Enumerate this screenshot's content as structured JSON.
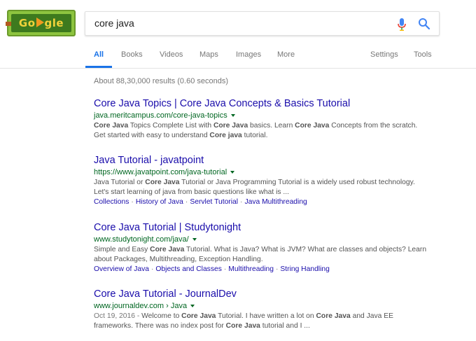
{
  "logo": {
    "text_pre": "Go",
    "text_post": "gle"
  },
  "search": {
    "query": "core java"
  },
  "tabs": [
    {
      "label": "All",
      "active": true
    },
    {
      "label": "Books"
    },
    {
      "label": "Videos"
    },
    {
      "label": "Maps"
    },
    {
      "label": "Images"
    },
    {
      "label": "More"
    },
    {
      "label": "Settings"
    },
    {
      "label": "Tools"
    }
  ],
  "stats": "About 88,30,000 results (0.60 seconds)",
  "results": [
    {
      "title": "Core Java Topics | Core Java Concepts & Basics Tutorial",
      "url": "java.meritcampus.com/core-java-topics",
      "snippet": [
        [
          [
            "b",
            "Core Java"
          ],
          [
            "t",
            " Topics Complete List with "
          ],
          [
            "b",
            "Core Java"
          ],
          [
            "t",
            " basics. Learn "
          ],
          [
            "b",
            "Core Java"
          ],
          [
            "t",
            " Concepts from the scratch."
          ]
        ],
        [
          [
            "t",
            "Get started with easy to understand "
          ],
          [
            "b",
            "Core java"
          ],
          [
            "t",
            " tutorial."
          ]
        ]
      ],
      "sitelinks": []
    },
    {
      "title": "Java Tutorial - javatpoint",
      "url": "https://www.javatpoint.com/java-tutorial",
      "snippet": [
        [
          [
            "t",
            "Java Tutorial or "
          ],
          [
            "b",
            "Core Java"
          ],
          [
            "t",
            " Tutorial or Java Programming Tutorial is a widely used robust technology."
          ]
        ],
        [
          [
            "t",
            "Let's start learning of java from basic questions like what is ..."
          ]
        ]
      ],
      "sitelinks": [
        "Collections",
        "History of Java",
        "Servlet Tutorial",
        "Java Multithreading"
      ]
    },
    {
      "title": "Core Java Tutorial | Studytonight",
      "url": "www.studytonight.com/java/",
      "snippet": [
        [
          [
            "t",
            "Simple and Easy "
          ],
          [
            "b",
            "Core Java"
          ],
          [
            "t",
            " Tutorial. What is Java? What is JVM? What are classes and objects? Learn"
          ]
        ],
        [
          [
            "t",
            "about Packages, Multithreading, Exception Handling."
          ]
        ]
      ],
      "sitelinks": [
        "Overview of Java",
        "Objects and Classes",
        "Multithreading",
        "String Handling"
      ]
    },
    {
      "title": "Core Java Tutorial - JournalDev",
      "url": "www.journaldev.com › Java",
      "snippet": [
        [
          [
            "d",
            "Oct 19, 2016 - "
          ],
          [
            "t",
            "Welcome to "
          ],
          [
            "b",
            "Core Java"
          ],
          [
            "t",
            " Tutorial. I have written a lot on "
          ],
          [
            "b",
            "Core Java"
          ],
          [
            "t",
            " and Java EE"
          ]
        ],
        [
          [
            "t",
            "frameworks. There was no index post for "
          ],
          [
            "b",
            "Core Java"
          ],
          [
            "t",
            " tutorial and I ..."
          ]
        ]
      ],
      "sitelinks": []
    }
  ],
  "colors": {
    "link": "#1a0dab",
    "url": "#006621",
    "accent": "#1a73e8",
    "snippet": "#545454"
  },
  "icons": {
    "mic": "microphone-icon",
    "search": "magnifier-icon",
    "caret": "caret-down-icon"
  }
}
